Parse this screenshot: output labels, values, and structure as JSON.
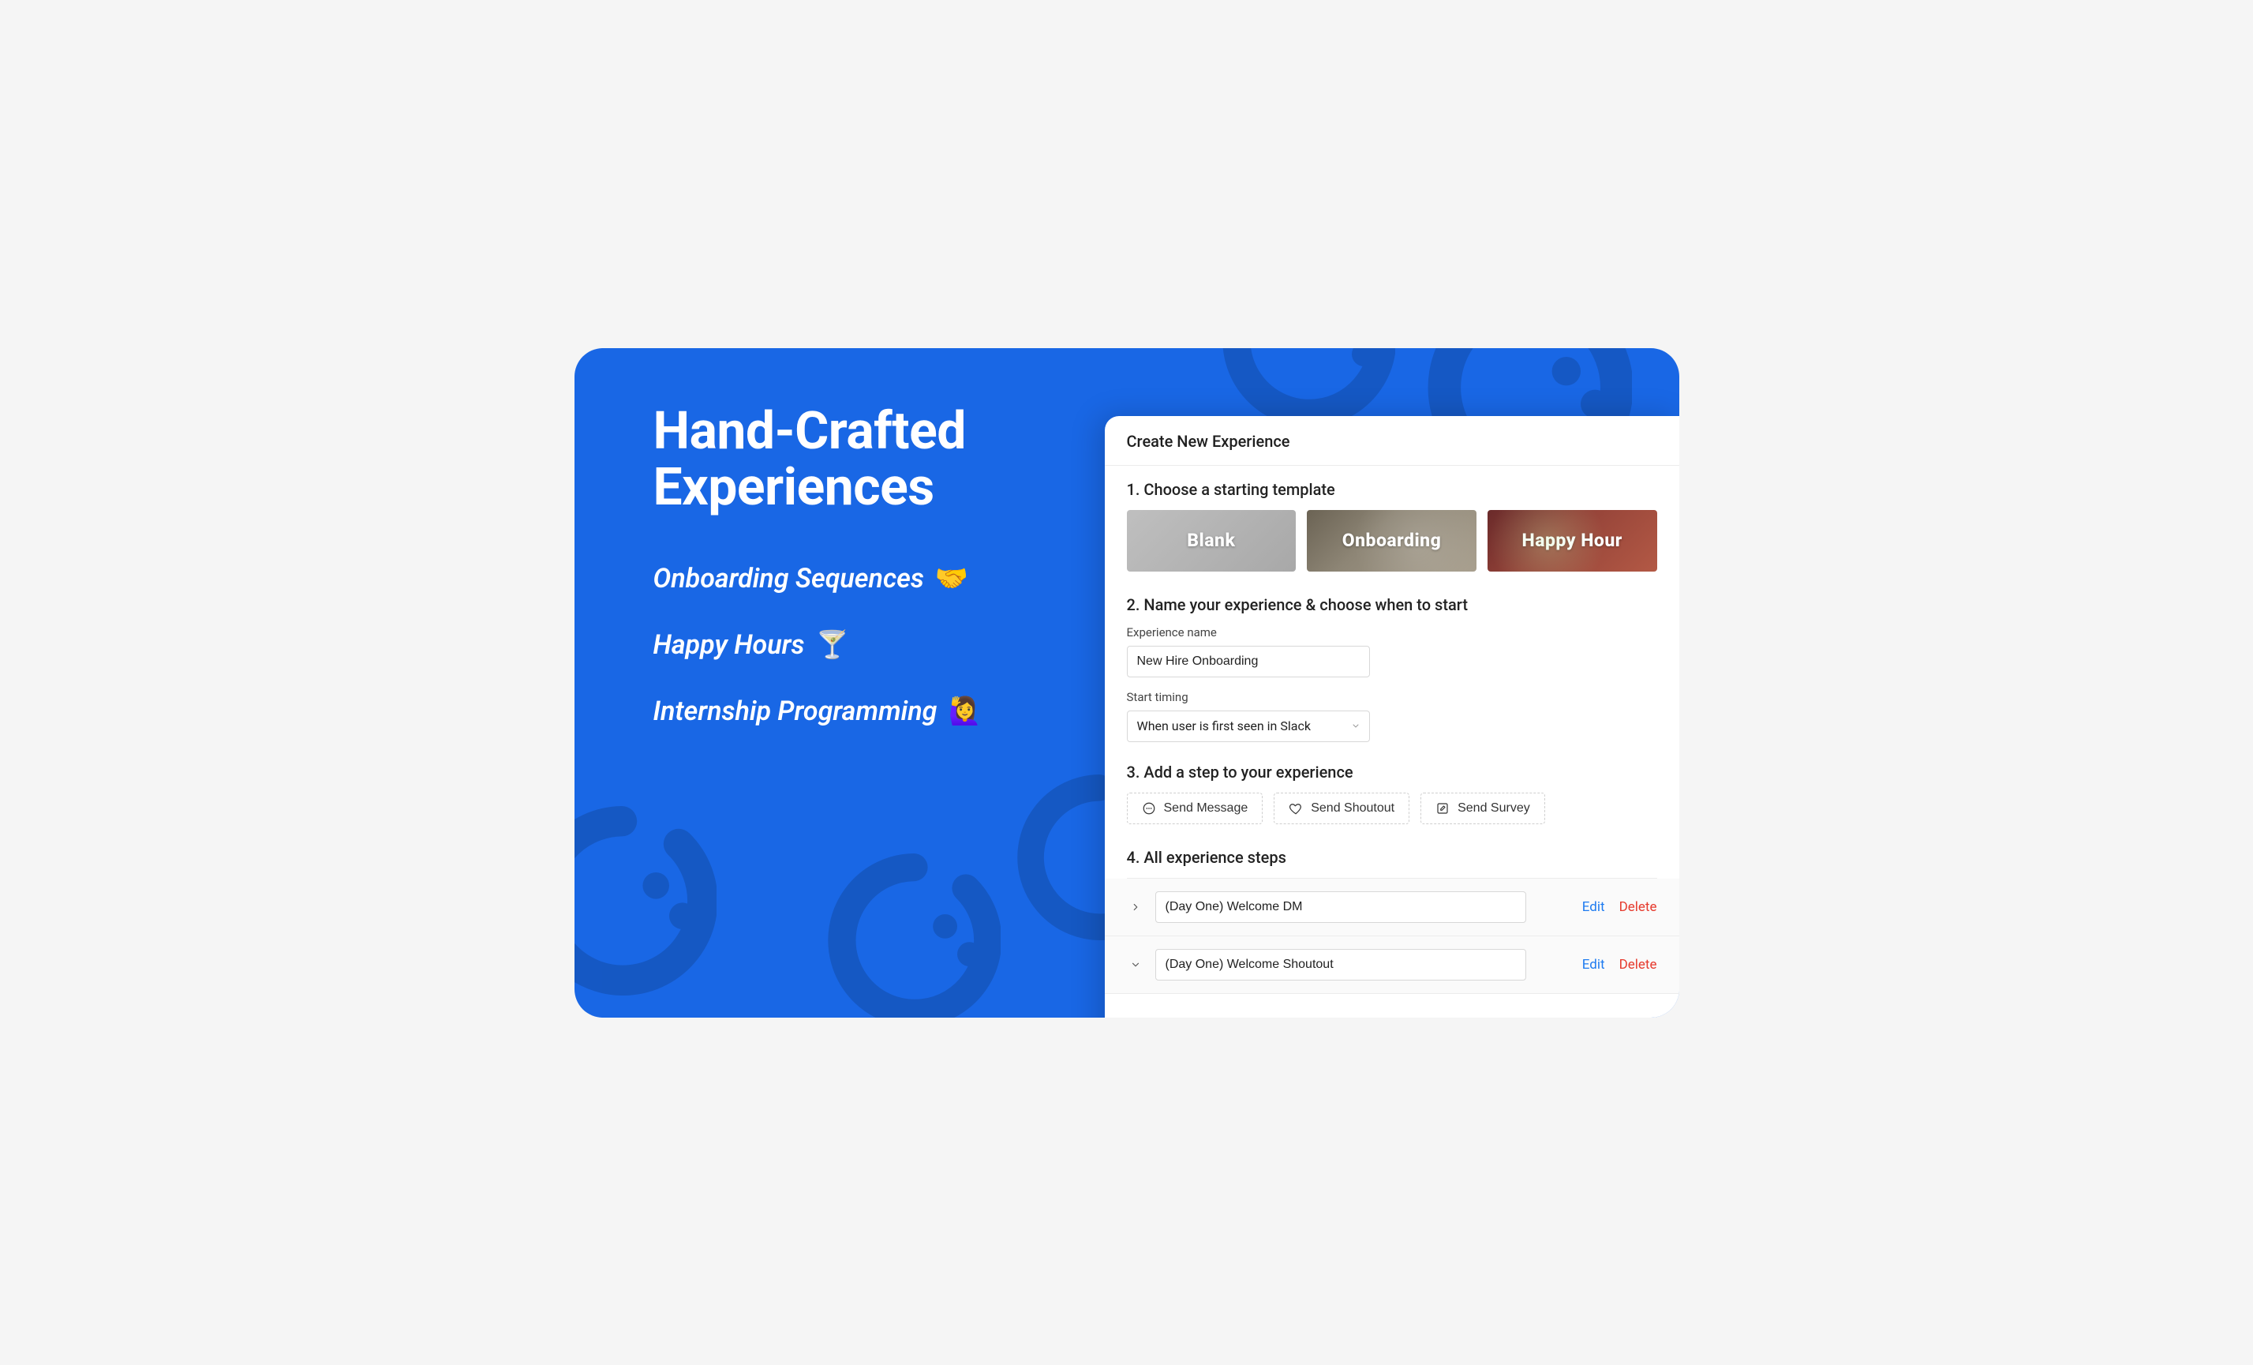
{
  "hero": {
    "title_line1": "Hand-Crafted",
    "title_line2": "Experiences",
    "features": [
      {
        "label": "Onboarding Sequences",
        "emoji": "🤝"
      },
      {
        "label": "Happy Hours",
        "emoji": "🍸"
      },
      {
        "label": "Internship Programming",
        "emoji": "🙋‍♀️"
      }
    ]
  },
  "panel": {
    "header": "Create New Experience",
    "section1": {
      "title": "1. Choose a starting template",
      "templates": [
        {
          "label": "Blank"
        },
        {
          "label": "Onboarding"
        },
        {
          "label": "Happy Hour"
        }
      ]
    },
    "section2": {
      "title": "2. Name your experience & choose when to start",
      "name_label": "Experience name",
      "name_value": "New Hire Onboarding",
      "timing_label": "Start timing",
      "timing_value": "When user is first seen in Slack"
    },
    "section3": {
      "title": "3. Add a step to your experience",
      "buttons": [
        {
          "label": "Send Message"
        },
        {
          "label": "Send Shoutout"
        },
        {
          "label": "Send Survey"
        }
      ]
    },
    "section4": {
      "title": "4. All experience steps",
      "edit_label": "Edit",
      "delete_label": "Delete",
      "steps": [
        {
          "name": "(Day One) Welcome DM",
          "expanded": false
        },
        {
          "name": "(Day One) Welcome Shoutout",
          "expanded": true
        }
      ]
    }
  }
}
